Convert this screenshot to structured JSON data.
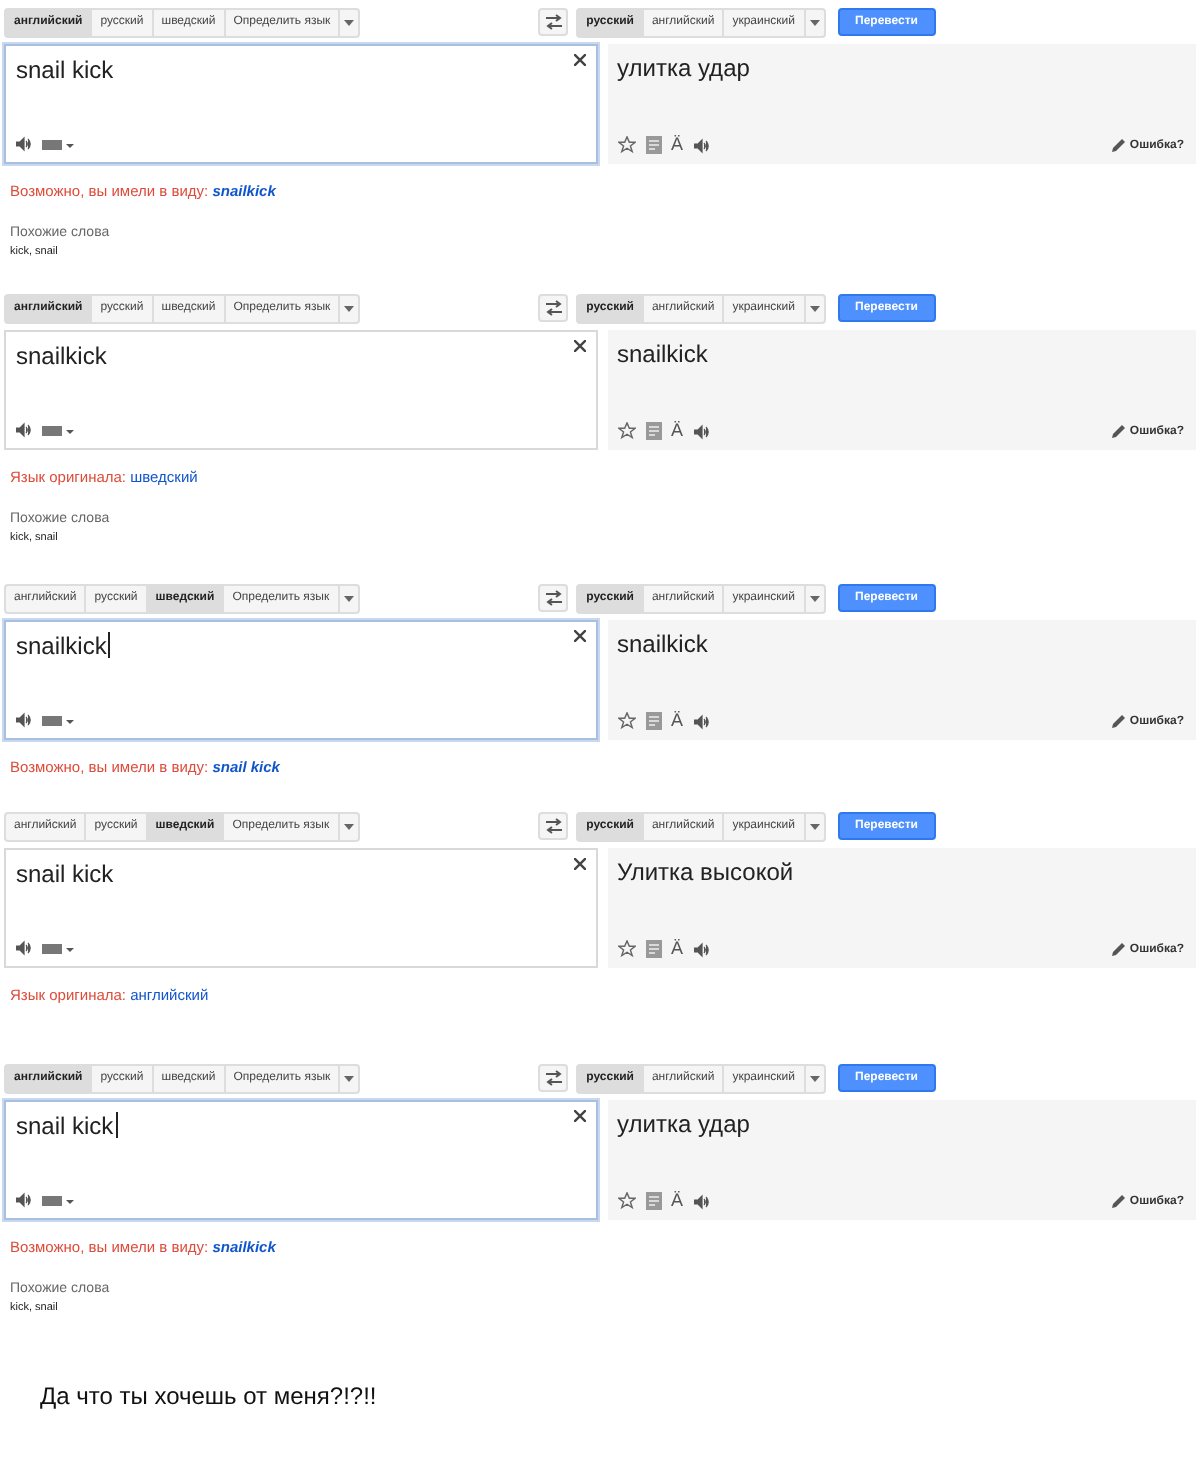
{
  "panels": [
    {
      "source_languages": [
        {
          "label": "английский",
          "selected": true
        },
        {
          "label": "русский",
          "selected": false
        },
        {
          "label": "шведский",
          "selected": false
        },
        {
          "label": "Определить язык",
          "selected": false
        }
      ],
      "target_languages": [
        {
          "label": "русский",
          "selected": true
        },
        {
          "label": "английский",
          "selected": false
        },
        {
          "label": "украинский",
          "selected": false
        }
      ],
      "translate_button": "Перевести",
      "source_text": "snail kick",
      "source_focused": true,
      "cursor": false,
      "translation": "улитка удар",
      "transliterate": "Ä",
      "report_link": "Ошибка?",
      "notice": {
        "kind": "did_you_mean",
        "label": "Возможно, вы имели в виду:",
        "value": "snailkick"
      },
      "similar_words": {
        "title": "Похожие слова",
        "words": "kick, snail"
      }
    },
    {
      "source_languages": [
        {
          "label": "английский",
          "selected": true
        },
        {
          "label": "русский",
          "selected": false
        },
        {
          "label": "шведский",
          "selected": false
        },
        {
          "label": "Определить язык",
          "selected": false
        }
      ],
      "target_languages": [
        {
          "label": "русский",
          "selected": true
        },
        {
          "label": "английский",
          "selected": false
        },
        {
          "label": "украинский",
          "selected": false
        }
      ],
      "translate_button": "Перевести",
      "source_text": "snailkick",
      "source_focused": false,
      "cursor": false,
      "translation": "snailkick",
      "transliterate": "Ä",
      "report_link": "Ошибка?",
      "notice": {
        "kind": "source_language",
        "label": "Язык оригинала:",
        "value": "шведский"
      },
      "similar_words": {
        "title": "Похожие слова",
        "words": "kick, snail"
      }
    },
    {
      "source_languages": [
        {
          "label": "английский",
          "selected": false
        },
        {
          "label": "русский",
          "selected": false
        },
        {
          "label": "шведский",
          "selected": true
        },
        {
          "label": "Определить язык",
          "selected": false
        }
      ],
      "target_languages": [
        {
          "label": "русский",
          "selected": true
        },
        {
          "label": "английский",
          "selected": false
        },
        {
          "label": "украинский",
          "selected": false
        }
      ],
      "translate_button": "Перевести",
      "source_text": "snailkick",
      "source_focused": true,
      "cursor": true,
      "translation": "snailkick",
      "transliterate": "Ä",
      "report_link": "Ошибка?",
      "notice": {
        "kind": "did_you_mean",
        "label": "Возможно, вы имели в виду:",
        "value": "snail kick"
      }
    },
    {
      "source_languages": [
        {
          "label": "английский",
          "selected": false
        },
        {
          "label": "русский",
          "selected": false
        },
        {
          "label": "шведский",
          "selected": true
        },
        {
          "label": "Определить язык",
          "selected": false
        }
      ],
      "target_languages": [
        {
          "label": "русский",
          "selected": true
        },
        {
          "label": "английский",
          "selected": false
        },
        {
          "label": "украинский",
          "selected": false
        }
      ],
      "translate_button": "Перевести",
      "source_text": "snail kick",
      "source_focused": false,
      "cursor": false,
      "translation": "Улитка высокой",
      "transliterate": "Ä",
      "report_link": "Ошибка?",
      "notice": {
        "kind": "source_language",
        "label": "Язык оригинала:",
        "value": "английский"
      }
    },
    {
      "source_languages": [
        {
          "label": "английский",
          "selected": true
        },
        {
          "label": "русский",
          "selected": false
        },
        {
          "label": "шведский",
          "selected": false
        },
        {
          "label": "Определить язык",
          "selected": false
        }
      ],
      "target_languages": [
        {
          "label": "русский",
          "selected": true
        },
        {
          "label": "английский",
          "selected": false
        },
        {
          "label": "украинский",
          "selected": false
        }
      ],
      "translate_button": "Перевести",
      "source_text": "snail kick",
      "source_focused": true,
      "cursor": true,
      "translation": "улитка удар",
      "transliterate": "Ä",
      "report_link": "Ошибка?",
      "notice": {
        "kind": "did_you_mean",
        "label": "Возможно, вы имели в виду:",
        "value": "snailkick"
      },
      "similar_words": {
        "title": "Похожие слова",
        "words": "kick, snail"
      }
    }
  ],
  "caption": "Да что ты хочешь от меня?!?!!"
}
